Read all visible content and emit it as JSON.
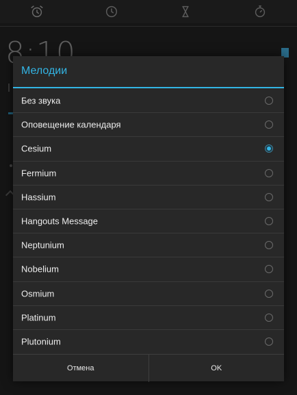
{
  "tabs": [
    {
      "name": "alarm-clock-icon"
    },
    {
      "name": "clock-icon"
    },
    {
      "name": "hourglass-icon"
    },
    {
      "name": "stopwatch-icon"
    }
  ],
  "background": {
    "clock_text": "8:10"
  },
  "dialog": {
    "title": "Мелодии",
    "items": [
      {
        "label": "Без звука",
        "selected": false
      },
      {
        "label": "Оповещение календаря",
        "selected": false
      },
      {
        "label": "Cesium",
        "selected": true
      },
      {
        "label": "Fermium",
        "selected": false
      },
      {
        "label": "Hassium",
        "selected": false
      },
      {
        "label": "Hangouts Message",
        "selected": false
      },
      {
        "label": "Neptunium",
        "selected": false
      },
      {
        "label": "Nobelium",
        "selected": false
      },
      {
        "label": "Osmium",
        "selected": false
      },
      {
        "label": "Platinum",
        "selected": false
      },
      {
        "label": "Plutonium",
        "selected": false
      }
    ],
    "cancel_label": "Отмена",
    "ok_label": "OK"
  },
  "colors": {
    "accent": "#33b5e5",
    "dialog_bg": "#282828",
    "text": "#ececec"
  }
}
